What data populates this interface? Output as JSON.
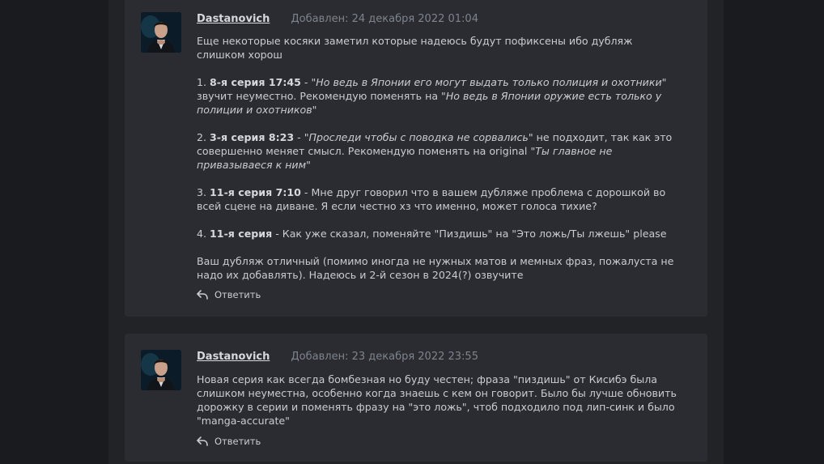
{
  "comments": [
    {
      "author": "Dastanovich",
      "date": "Добавлен: 24 декабря 2022 01:04",
      "reply_label": "Ответить",
      "p1": "Еще некоторые косяки заметил которые надеюсь будут пофиксены ибо дубляж слишком хорош",
      "item1": {
        "num": "1.",
        "ref": "8-я серия 17:45",
        "dash": " - ",
        "quote1": "\"Но ведь в Японии его могут выдать только полиция и охотники\"",
        "mid": " звучит неуместно. Рекомендую поменять на ",
        "quote2": "\"Но ведь в Японии оружие есть только у полиции и охотников\""
      },
      "item2": {
        "num": "2.",
        "ref": "3-я серия 8:23",
        "dash": " - ",
        "quote1": "\"Проследи чтобы с поводка не сорвались\"",
        "mid": " не подходит, так как это совершенно меняет смысл. Рекомендую поменять на original ",
        "quote2": "\"Ты главное не привазываеся к ним\""
      },
      "item3": {
        "num": "3.",
        "ref": "11-я серия 7:10",
        "text": " - Мне друг говорил что в вашем дубляже проблема с дорошкой во всей сцене на диване. Я если честно хз что именно, может голоса тихие?"
      },
      "item4": {
        "num": "4.",
        "ref": "11-я серия",
        "text": " - Как уже сказал, поменяйте \"Пиздишь\" на \"Это ложь/Ты лжешь\" please"
      },
      "p_last": "Ваш дубляж отличный (помимо иногда не нужных матов и мемных фраз, пожалуста не надо их добавлять). Надеюсь и 2-й сезон в 2024(?) озвучите"
    },
    {
      "author": "Dastanovich",
      "date": "Добавлен: 23 декабря 2022 23:55",
      "reply_label": "Ответить",
      "p1": "Новая серия как всегда бомбезная но буду честен; фраза \"пиздишь\" от Кисибэ была слишком неуместна, особенно когда знаешь с кем он говорит. Было бы лучше обновить дорожку в серии и поменять фразу на \"это ложь\", чтоб подходило под лип-синк и было \"manga-accurate\""
    }
  ],
  "icons": {
    "avatar": "avatar-icon",
    "reply": "reply-arrow-icon"
  },
  "colors": {
    "background": "#1b1c1f",
    "card": "#2a2c32",
    "date": "#7f838b"
  }
}
